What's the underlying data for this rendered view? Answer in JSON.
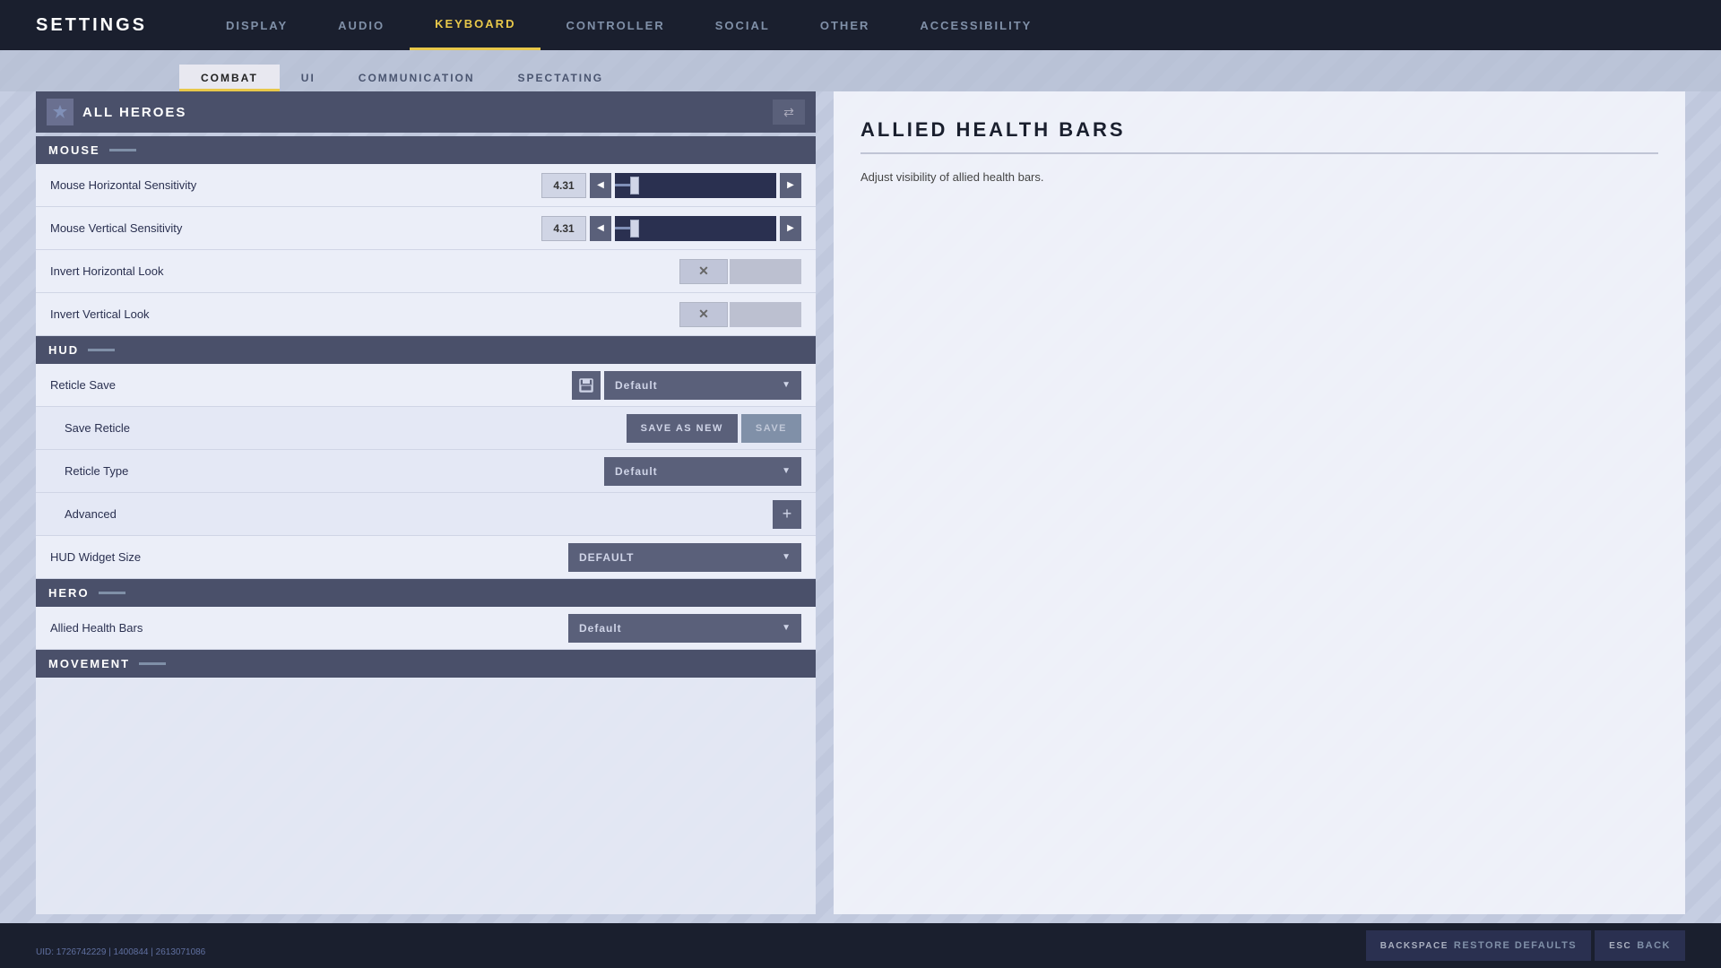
{
  "app": {
    "title": "SETTINGS"
  },
  "nav": {
    "items": [
      {
        "label": "DISPLAY",
        "active": false
      },
      {
        "label": "AUDIO",
        "active": false
      },
      {
        "label": "KEYBOARD",
        "active": true
      },
      {
        "label": "CONTROLLER",
        "active": false
      },
      {
        "label": "SOCIAL",
        "active": false
      },
      {
        "label": "OTHER",
        "active": false
      },
      {
        "label": "ACCESSIBILITY",
        "active": false
      }
    ]
  },
  "sub_tabs": {
    "items": [
      {
        "label": "COMBAT",
        "active": true
      },
      {
        "label": "UI",
        "active": false
      },
      {
        "label": "COMMUNICATION",
        "active": false
      },
      {
        "label": "SPECTATING",
        "active": false
      }
    ]
  },
  "hero_selector": {
    "label": "ALL HEROES"
  },
  "sections": {
    "mouse": {
      "title": "MOUSE",
      "settings": [
        {
          "label": "Mouse Horizontal Sensitivity",
          "type": "slider",
          "value": "4.31",
          "fill_pct": 12
        },
        {
          "label": "Mouse Vertical Sensitivity",
          "type": "slider",
          "value": "4.31",
          "fill_pct": 12
        },
        {
          "label": "Invert Horizontal Look",
          "type": "toggle",
          "value": "off"
        },
        {
          "label": "Invert Vertical Look",
          "type": "toggle",
          "value": "off"
        }
      ]
    },
    "hud": {
      "title": "HUD",
      "settings": [
        {
          "label": "Reticle Save",
          "type": "reticle_save",
          "dropdown_value": "Default"
        },
        {
          "label": "Save Reticle",
          "type": "save_reticle",
          "sub": true
        },
        {
          "label": "Reticle Type",
          "type": "dropdown",
          "value": "Default",
          "sub": true
        },
        {
          "label": "Advanced",
          "type": "plus",
          "sub": true
        },
        {
          "label": "HUD Widget Size",
          "type": "dropdown_wide",
          "value": "DEFAULT"
        }
      ]
    },
    "hero": {
      "title": "HERO",
      "settings": [
        {
          "label": "Allied Health Bars",
          "type": "dropdown",
          "value": "Default"
        }
      ]
    },
    "movement": {
      "title": "MOVEMENT"
    }
  },
  "detail_panel": {
    "title": "ALLIED HEALTH BARS",
    "description": "Adjust visibility of allied health bars."
  },
  "bottom_bar": {
    "backspace_key": "BACKSPACE",
    "restore_label": "RESTORE DEFAULTS",
    "esc_key": "ESC",
    "back_label": "BACK"
  },
  "watermark": "UID: 1726742229 | 1400844 | 2613071086",
  "buttons": {
    "save_as_new": "SAVE AS NEW",
    "save": "SAVE"
  }
}
